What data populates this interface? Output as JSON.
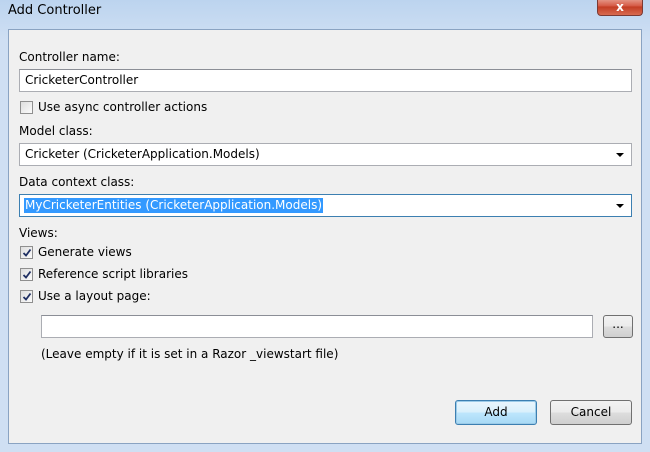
{
  "window": {
    "title": "Add Controller",
    "close_glyph": "x"
  },
  "form": {
    "controller_name_label": "Controller name:",
    "controller_name_value": "CricketerController",
    "async_label": "Use async controller actions",
    "async_checked": false,
    "model_class_label": "Model class:",
    "model_class_value": "Cricketer (CricketerApplication.Models)",
    "data_context_label": "Data context class:",
    "data_context_value": "MyCricketerEntities (CricketerApplication.Models)",
    "views_label": "Views:",
    "generate_views_label": "Generate views",
    "generate_views_checked": true,
    "reference_scripts_label": "Reference script libraries",
    "reference_scripts_checked": true,
    "layout_page_label": "Use a layout page:",
    "layout_page_checked": true,
    "layout_page_value": "",
    "browse_label": "...",
    "layout_hint": "(Leave empty if it is set in a Razor _viewstart file)"
  },
  "buttons": {
    "add_label": "Add",
    "cancel_label": "Cancel"
  },
  "colors": {
    "selection": "#3399ff",
    "close_button": "#c23b22",
    "default_button_border": "#3c7fb1"
  }
}
